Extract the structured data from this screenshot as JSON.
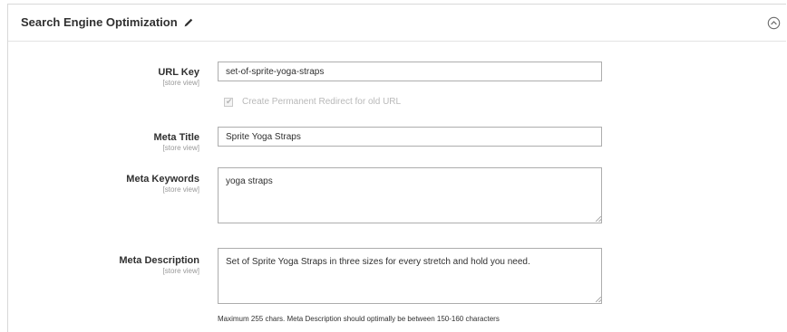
{
  "section": {
    "title": "Search Engine Optimization"
  },
  "fields": {
    "url_key": {
      "label": "URL Key",
      "scope": "[store view]",
      "value": "set-of-sprite-yoga-straps"
    },
    "redirect": {
      "label": "Create Permanent Redirect for old URL",
      "checked": true
    },
    "meta_title": {
      "label": "Meta Title",
      "scope": "[store view]",
      "value": "Sprite Yoga Straps"
    },
    "meta_keywords": {
      "label": "Meta Keywords",
      "scope": "[store view]",
      "value": "yoga straps"
    },
    "meta_description": {
      "label": "Meta Description",
      "scope": "[store view]",
      "value": "Set of Sprite Yoga Straps in three sizes for every stretch and hold you need.",
      "note": "Maximum 255 chars. Meta Description should optimally be between 150-160 characters"
    }
  },
  "colors": {
    "input_border": "#adadad",
    "label_text": "#303030",
    "scope_text": "#999999",
    "disabled_text": "#b9b9b9"
  },
  "icons": {
    "edit": "pencil-icon",
    "collapse": "chevron-up-circle-icon"
  }
}
